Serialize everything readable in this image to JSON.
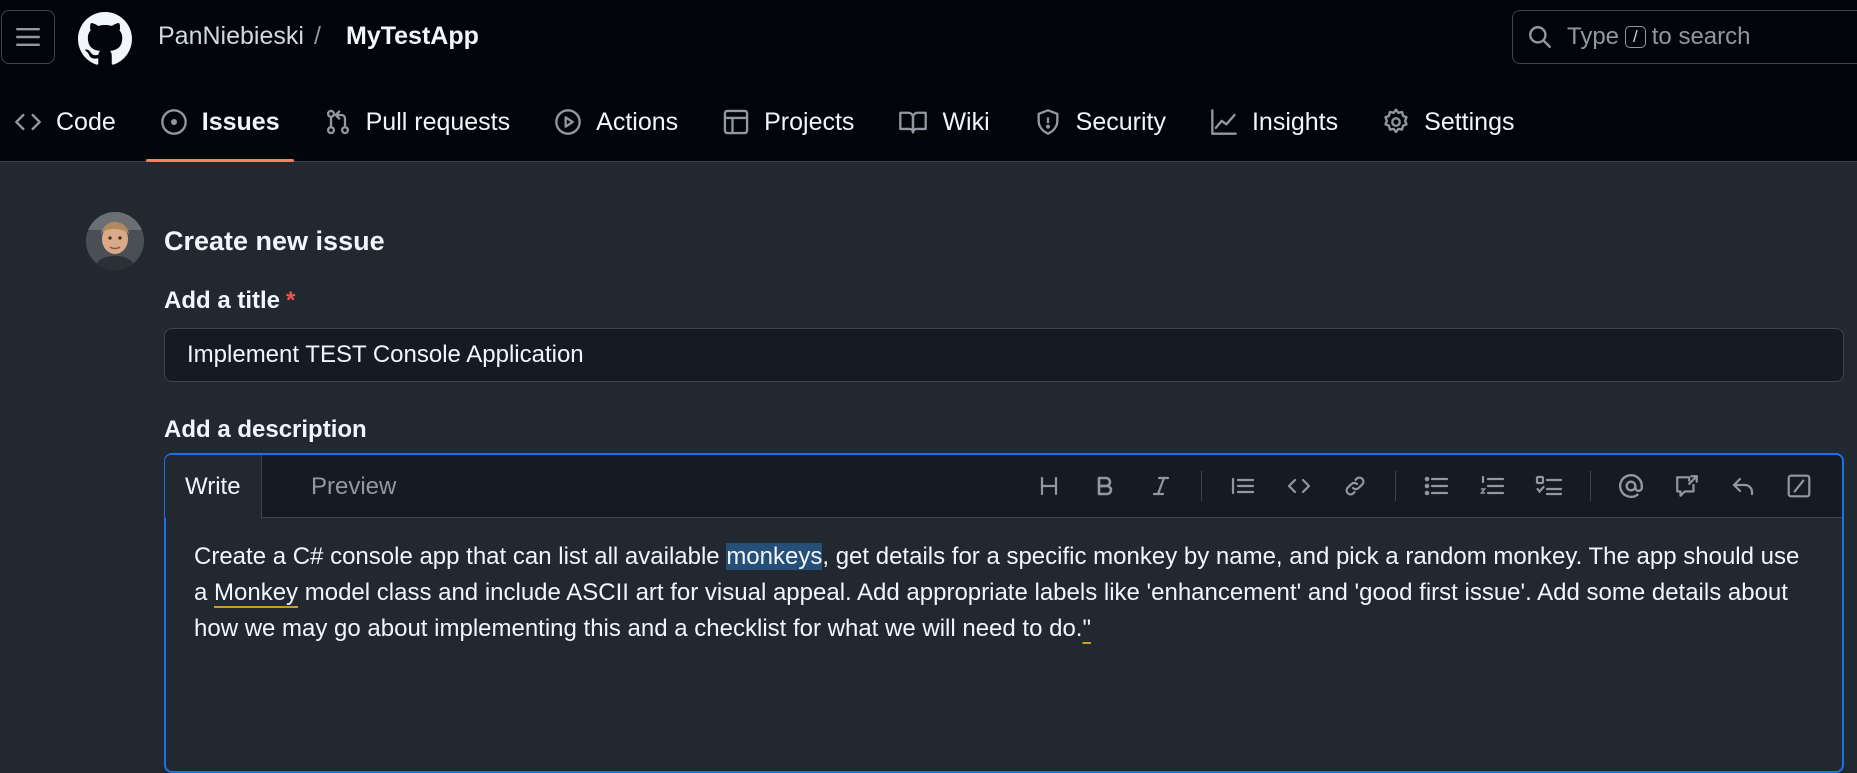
{
  "header": {
    "owner": "PanNiebieski",
    "separator": "/",
    "repo": "MyTestApp",
    "search": {
      "prefix": "Type",
      "key": "/",
      "suffix": "to search"
    },
    "icons": {
      "menu": "hamburger-icon",
      "logo": "github-logo",
      "search": "search-icon"
    }
  },
  "nav": {
    "tabs": [
      {
        "label": "Code",
        "icon": "code-icon"
      },
      {
        "label": "Issues",
        "icon": "issue-opened-icon",
        "selected": true
      },
      {
        "label": "Pull requests",
        "icon": "pull-request-icon"
      },
      {
        "label": "Actions",
        "icon": "play-icon"
      },
      {
        "label": "Projects",
        "icon": "table-icon"
      },
      {
        "label": "Wiki",
        "icon": "book-icon"
      },
      {
        "label": "Security",
        "icon": "shield-icon"
      },
      {
        "label": "Insights",
        "icon": "graph-icon"
      },
      {
        "label": "Settings",
        "icon": "gear-icon"
      }
    ],
    "selected_color": "#f78166"
  },
  "form": {
    "page_title": "Create new issue",
    "title_label": "Add a title",
    "required_mark": "*",
    "title_value": "Implement TEST Console Application",
    "description_label": "Add a description",
    "editor_tabs": {
      "write": "Write",
      "preview": "Preview"
    },
    "toolbar": [
      "heading-icon",
      "bold-icon",
      "italic-icon",
      "quote-icon",
      "code-icon",
      "link-icon",
      "unordered-list-icon",
      "ordered-list-icon",
      "task-list-icon",
      "mention-icon",
      "cross-reference-icon",
      "saved-replies-icon",
      "slash-command-icon"
    ],
    "description_parts": {
      "p1": "Create a C# console app that can list all available ",
      "p2_selected": "monkeys",
      "p3": ", get details for a specific monkey by name, and pick a random monkey. The app should use a ",
      "p4_spell": "Monkey",
      "p5": " model class and include ASCII art for visual appeal. Add appropriate labels like 'enhancement' and 'good first issue'. Add some details about how we may go about implementing this and a checklist for what we will need to do.",
      "p6_spell": "\""
    },
    "accent_color": "#1f6feb"
  }
}
